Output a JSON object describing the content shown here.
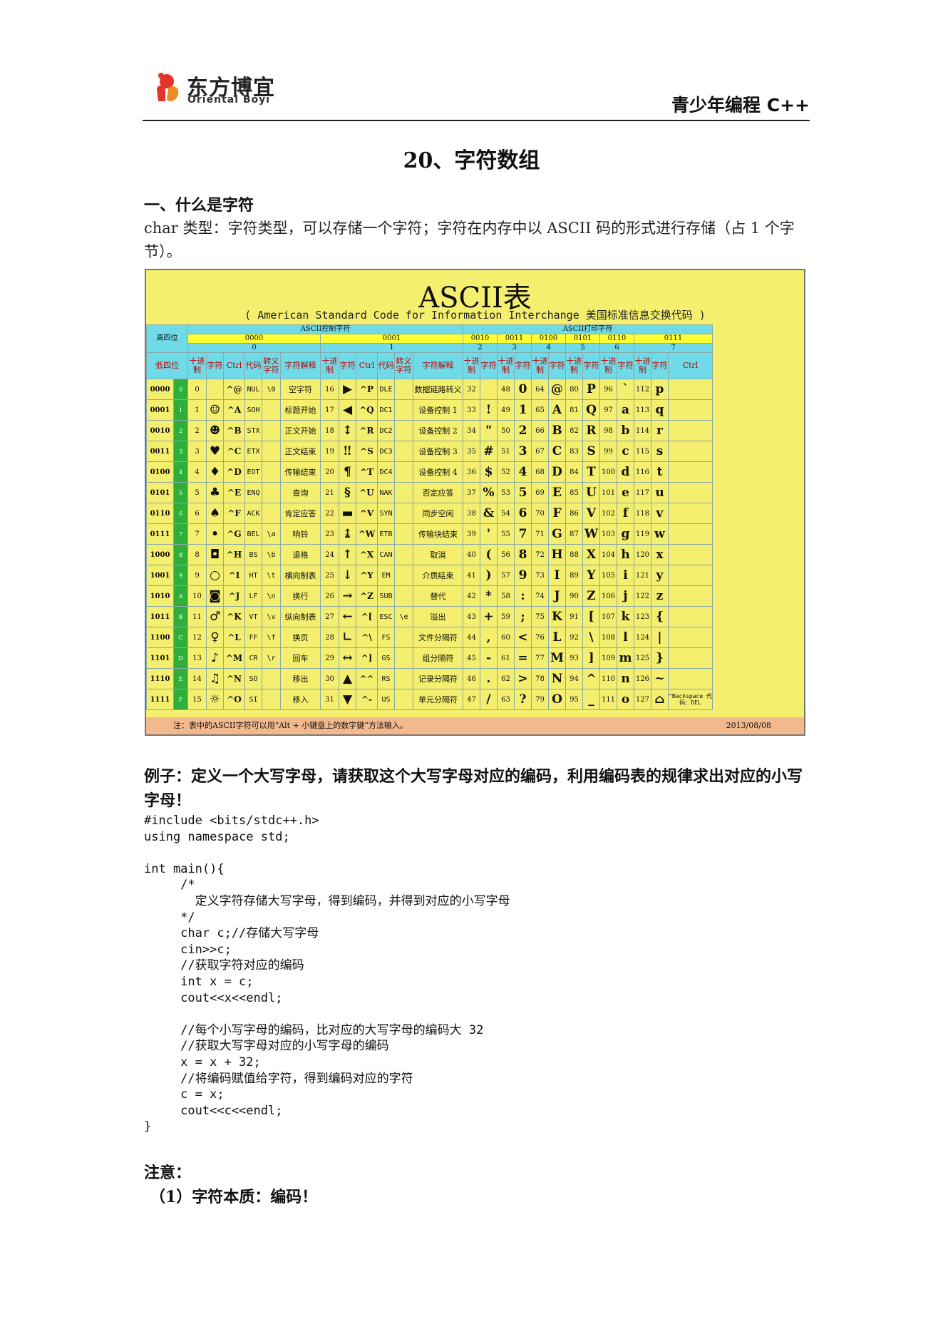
{
  "header": {
    "logo_cn": "东方博宜",
    "logo_en": "Oriental Boyi",
    "course": "青少年编程 C++"
  },
  "title": "20、字符数组",
  "section1": {
    "heading": "一、什么是字符",
    "text": "char 类型：字符类型，可以存储一个字符；字符在内存中以 ASCII 码的形式进行存储（占 1 个字节）。"
  },
  "ascii_image": {
    "title": "ASCII表",
    "subtitle": "( American Standard Code for Information Interchange  美国标准信息交换代码 )",
    "high_label": "高四位",
    "low_label": "低四位",
    "group_ctrl": "ASCII控制字符",
    "group_print": "ASCII打印字符",
    "high_bins": [
      "0000",
      "0001",
      "0010",
      "0011",
      "0100",
      "0101",
      "0110",
      "0111"
    ],
    "high_hex": [
      "0",
      "1",
      "2",
      "3",
      "4",
      "5",
      "6",
      "7"
    ],
    "sub_ctrl": [
      "十进制",
      "字符",
      "Ctrl",
      "代码",
      "转义字符",
      "字符解释"
    ],
    "sub_print": [
      "十进制",
      "字符"
    ],
    "sub_ctrl_last": "Ctrl",
    "rows": [
      {
        "bin": "0000",
        "hex": "0",
        "c0": [
          "0",
          "",
          "^@",
          "NUL",
          "\\0",
          "空字符"
        ],
        "c1": [
          "16",
          "▶",
          "^P",
          "DLE",
          "",
          "数据链路转义"
        ],
        "p": [
          [
            "32",
            ""
          ],
          [
            "48",
            "0"
          ],
          [
            "64",
            "@"
          ],
          [
            "80",
            "P"
          ],
          [
            "96",
            "`"
          ],
          [
            "112",
            "p"
          ]
        ],
        "last": ""
      },
      {
        "bin": "0001",
        "hex": "1",
        "c0": [
          "1",
          "☺",
          "^A",
          "SOH",
          "",
          "标题开始"
        ],
        "c1": [
          "17",
          "◀",
          "^Q",
          "DC1",
          "",
          "设备控制 1"
        ],
        "p": [
          [
            "33",
            "!"
          ],
          [
            "49",
            "1"
          ],
          [
            "65",
            "A"
          ],
          [
            "81",
            "Q"
          ],
          [
            "97",
            "a"
          ],
          [
            "113",
            "q"
          ]
        ],
        "last": ""
      },
      {
        "bin": "0010",
        "hex": "2",
        "c0": [
          "2",
          "☻",
          "^B",
          "STX",
          "",
          "正文开始"
        ],
        "c1": [
          "18",
          "↕",
          "^R",
          "DC2",
          "",
          "设备控制 2"
        ],
        "p": [
          [
            "34",
            "\""
          ],
          [
            "50",
            "2"
          ],
          [
            "66",
            "B"
          ],
          [
            "82",
            "R"
          ],
          [
            "98",
            "b"
          ],
          [
            "114",
            "r"
          ]
        ],
        "last": ""
      },
      {
        "bin": "0011",
        "hex": "3",
        "c0": [
          "3",
          "♥",
          "^C",
          "ETX",
          "",
          "正文结束"
        ],
        "c1": [
          "19",
          "‼",
          "^S",
          "DC3",
          "",
          "设备控制 3"
        ],
        "p": [
          [
            "35",
            "#"
          ],
          [
            "51",
            "3"
          ],
          [
            "67",
            "C"
          ],
          [
            "83",
            "S"
          ],
          [
            "99",
            "c"
          ],
          [
            "115",
            "s"
          ]
        ],
        "last": ""
      },
      {
        "bin": "0100",
        "hex": "4",
        "c0": [
          "4",
          "♦",
          "^D",
          "EOT",
          "",
          "传输结束"
        ],
        "c1": [
          "20",
          "¶",
          "^T",
          "DC4",
          "",
          "设备控制 4"
        ],
        "p": [
          [
            "36",
            "$"
          ],
          [
            "52",
            "4"
          ],
          [
            "68",
            "D"
          ],
          [
            "84",
            "T"
          ],
          [
            "100",
            "d"
          ],
          [
            "116",
            "t"
          ]
        ],
        "last": ""
      },
      {
        "bin": "0101",
        "hex": "5",
        "c0": [
          "5",
          "♣",
          "^E",
          "ENQ",
          "",
          "查询"
        ],
        "c1": [
          "21",
          "§",
          "^U",
          "NAK",
          "",
          "否定应答"
        ],
        "p": [
          [
            "37",
            "%"
          ],
          [
            "53",
            "5"
          ],
          [
            "69",
            "E"
          ],
          [
            "85",
            "U"
          ],
          [
            "101",
            "e"
          ],
          [
            "117",
            "u"
          ]
        ],
        "last": ""
      },
      {
        "bin": "0110",
        "hex": "6",
        "c0": [
          "6",
          "♠",
          "^F",
          "ACK",
          "",
          "肯定应答"
        ],
        "c1": [
          "22",
          "▬",
          "^V",
          "SYN",
          "",
          "同步空闲"
        ],
        "p": [
          [
            "38",
            "&"
          ],
          [
            "54",
            "6"
          ],
          [
            "70",
            "F"
          ],
          [
            "86",
            "V"
          ],
          [
            "102",
            "f"
          ],
          [
            "118",
            "v"
          ]
        ],
        "last": ""
      },
      {
        "bin": "0111",
        "hex": "7",
        "c0": [
          "7",
          "•",
          "^G",
          "BEL",
          "\\a",
          "响铃"
        ],
        "c1": [
          "23",
          "↨",
          "^W",
          "ETB",
          "",
          "传输块结束"
        ],
        "p": [
          [
            "39",
            "'"
          ],
          [
            "55",
            "7"
          ],
          [
            "71",
            "G"
          ],
          [
            "87",
            "W"
          ],
          [
            "103",
            "g"
          ],
          [
            "119",
            "w"
          ]
        ],
        "last": ""
      },
      {
        "bin": "1000",
        "hex": "8",
        "c0": [
          "8",
          "◘",
          "^H",
          "BS",
          "\\b",
          "退格"
        ],
        "c1": [
          "24",
          "↑",
          "^X",
          "CAN",
          "",
          "取消"
        ],
        "p": [
          [
            "40",
            "("
          ],
          [
            "56",
            "8"
          ],
          [
            "72",
            "H"
          ],
          [
            "88",
            "X"
          ],
          [
            "104",
            "h"
          ],
          [
            "120",
            "x"
          ]
        ],
        "last": ""
      },
      {
        "bin": "1001",
        "hex": "9",
        "c0": [
          "9",
          "○",
          "^I",
          "HT",
          "\\t",
          "横向制表"
        ],
        "c1": [
          "25",
          "↓",
          "^Y",
          "EM",
          "",
          "介质结束"
        ],
        "p": [
          [
            "41",
            ")"
          ],
          [
            "57",
            "9"
          ],
          [
            "73",
            "I"
          ],
          [
            "89",
            "Y"
          ],
          [
            "105",
            "i"
          ],
          [
            "121",
            "y"
          ]
        ],
        "last": ""
      },
      {
        "bin": "1010",
        "hex": "A",
        "c0": [
          "10",
          "◙",
          "^J",
          "LF",
          "\\n",
          "换行"
        ],
        "c1": [
          "26",
          "→",
          "^Z",
          "SUB",
          "",
          "替代"
        ],
        "p": [
          [
            "42",
            "*"
          ],
          [
            "58",
            ":"
          ],
          [
            "74",
            "J"
          ],
          [
            "90",
            "Z"
          ],
          [
            "106",
            "j"
          ],
          [
            "122",
            "z"
          ]
        ],
        "last": ""
      },
      {
        "bin": "1011",
        "hex": "B",
        "c0": [
          "11",
          "♂",
          "^K",
          "VT",
          "\\v",
          "纵向制表"
        ],
        "c1": [
          "27",
          "←",
          "^[",
          "ESC",
          "\\e",
          "溢出"
        ],
        "p": [
          [
            "43",
            "+"
          ],
          [
            "59",
            ";"
          ],
          [
            "75",
            "K"
          ],
          [
            "91",
            "["
          ],
          [
            "107",
            "k"
          ],
          [
            "123",
            "{"
          ]
        ],
        "last": ""
      },
      {
        "bin": "1100",
        "hex": "C",
        "c0": [
          "12",
          "♀",
          "^L",
          "FF",
          "\\f",
          "换页"
        ],
        "c1": [
          "28",
          "∟",
          "^\\",
          "FS",
          "",
          "文件分隔符"
        ],
        "p": [
          [
            "44",
            ","
          ],
          [
            "60",
            "<"
          ],
          [
            "76",
            "L"
          ],
          [
            "92",
            "\\"
          ],
          [
            "108",
            "l"
          ],
          [
            "124",
            "|"
          ]
        ],
        "last": ""
      },
      {
        "bin": "1101",
        "hex": "D",
        "c0": [
          "13",
          "♪",
          "^M",
          "CR",
          "\\r",
          "回车"
        ],
        "c1": [
          "29",
          "↔",
          "^]",
          "GS",
          "",
          "组分隔符"
        ],
        "p": [
          [
            "45",
            "-"
          ],
          [
            "61",
            "="
          ],
          [
            "77",
            "M"
          ],
          [
            "93",
            "]"
          ],
          [
            "109",
            "m"
          ],
          [
            "125",
            "}"
          ]
        ],
        "last": ""
      },
      {
        "bin": "1110",
        "hex": "E",
        "c0": [
          "14",
          "♫",
          "^N",
          "SO",
          "",
          "移出"
        ],
        "c1": [
          "30",
          "▲",
          "^^",
          "RS",
          "",
          "记录分隔符"
        ],
        "p": [
          [
            "46",
            "."
          ],
          [
            "62",
            ">"
          ],
          [
            "78",
            "N"
          ],
          [
            "94",
            "^"
          ],
          [
            "110",
            "n"
          ],
          [
            "126",
            "~"
          ]
        ],
        "last": ""
      },
      {
        "bin": "1111",
        "hex": "F",
        "c0": [
          "15",
          "☼",
          "^O",
          "SI",
          "",
          "移入"
        ],
        "c1": [
          "31",
          "▼",
          "^-",
          "US",
          "",
          "单元分隔符"
        ],
        "p": [
          [
            "47",
            "/"
          ],
          [
            "63",
            "?"
          ],
          [
            "79",
            "O"
          ],
          [
            "95",
            "_"
          ],
          [
            "111",
            "o"
          ],
          [
            "127",
            "⌂"
          ]
        ],
        "last": "^Backspace 代码：DEL"
      }
    ],
    "footnote": "注：表中的ASCII字符可以用“Alt + 小键盘上的数字键”方法输入。",
    "date": "2013/08/08"
  },
  "example": {
    "heading": "例子：定义一个大写字母，请获取这个大写字母对应的编码，利用编码表的规律求出对应的小写字母！",
    "code": "#include <bits/stdc++.h>\nusing namespace std;\n\nint main(){\n     /*\n       定义字符存储大写字母，得到编码，并得到对应的小写字母\n     */\n     char c;//存储大写字母\n     cin>>c;\n     //获取字符对应的编码\n     int x = c;\n     cout<<x<<endl;\n\n     //每个小写字母的编码，比对应的大写字母的编码大 32\n     //获取大写字母对应的小写字母的编码\n     x = x + 32;\n     //将编码赋值给字符，得到编码对应的字符\n     c = x;\n     cout<<c<<endl;\n}"
  },
  "notes": {
    "heading": "注意：",
    "item1": "（1）字符本质：编码！"
  },
  "colors": {
    "table_bg": "#f4ef6e",
    "header_cyan": "#6fdbe8",
    "hex_green": "#2fae3a",
    "footer_orange": "#f3b98d"
  }
}
